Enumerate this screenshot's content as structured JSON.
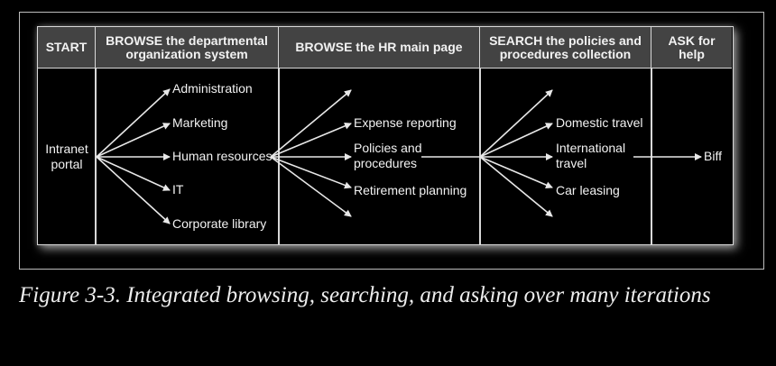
{
  "headers": {
    "start": "START",
    "browse_departmental": "BROWSE the departmental organization system",
    "browse_hr": "BROWSE the HR main page",
    "search": "SEARCH the policies and procedures collection",
    "ask": "ASK for help"
  },
  "nodes": {
    "intranet_portal": "Intranet portal",
    "departments": [
      "Administration",
      "Marketing",
      "Human resources",
      "IT",
      "Corporate library"
    ],
    "hr_pages": [
      "Expense reporting",
      "Policies and procedures",
      "Retirement planning"
    ],
    "policies": [
      "Domestic travel",
      "International travel",
      "Car leasing"
    ],
    "helper": "Biff"
  },
  "caption": "Figure 3-3. Integrated browsing, searching, and asking over many iterations",
  "colors": {
    "background": "#000000",
    "header_fill": "#434343",
    "line": "#e8e8e8",
    "text": "#f2f2f2"
  }
}
